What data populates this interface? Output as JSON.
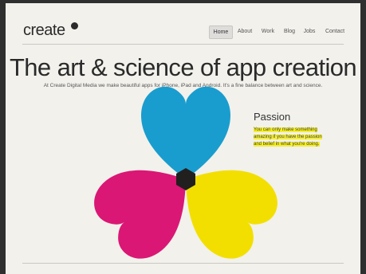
{
  "brand": {
    "logo_text": "create"
  },
  "nav": {
    "items": [
      {
        "label": "Home",
        "active": true
      },
      {
        "label": "About"
      },
      {
        "label": "Work"
      },
      {
        "label": "Blog"
      },
      {
        "label": "Jobs"
      },
      {
        "label": "Contact"
      }
    ]
  },
  "hero": {
    "headline": "The art & science of app creation",
    "tagline": "At Create Digital Media we make beautiful apps for iPhone, iPad and Android. It's a fine balance between art and science."
  },
  "passion": {
    "title": "Passion",
    "body": "You can only make something amazing if you have the passion and belief in what you're doing."
  },
  "colors": {
    "cyan": "#1aa6df",
    "magenta": "#e6187d",
    "yellow": "#ffec00",
    "highlight": "#f5ef2b",
    "frame_bg": "#f2f1ec",
    "border": "#2f2f2f"
  }
}
